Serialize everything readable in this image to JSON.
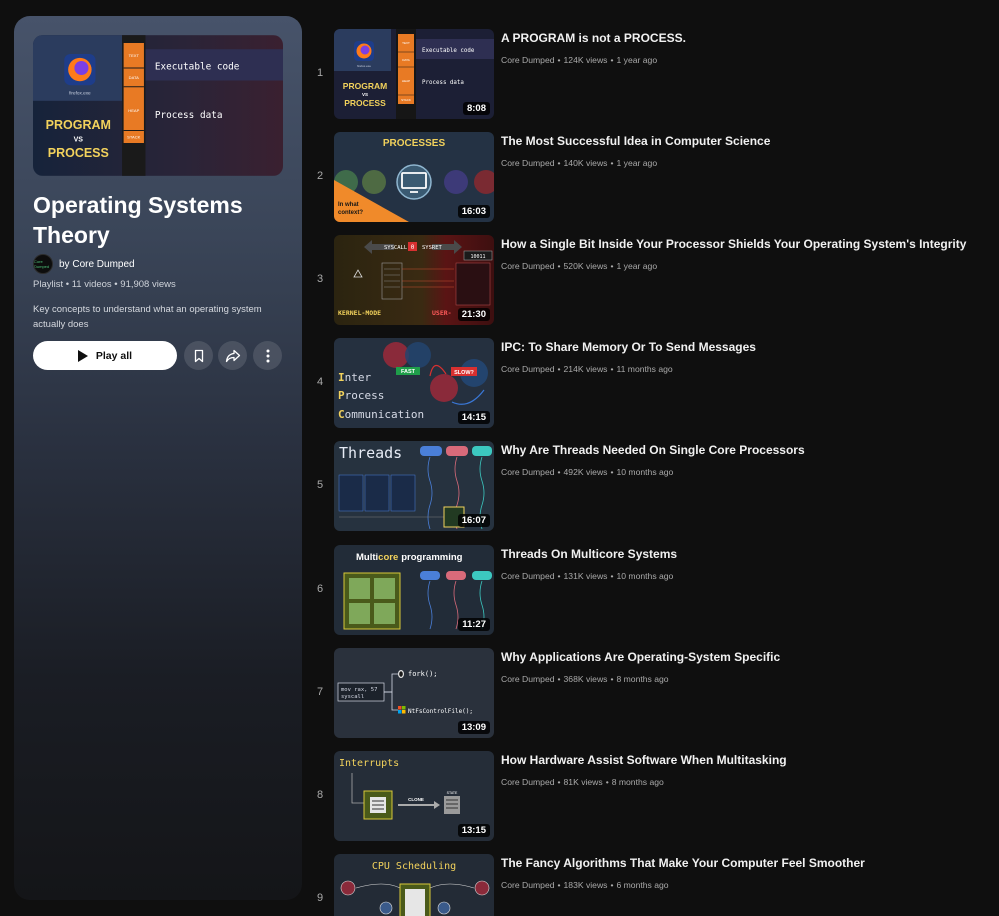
{
  "playlist": {
    "cover": {
      "title_line1": "PROGRAM",
      "title_vs": "VS",
      "title_line2": "PROCESS",
      "app_name": "firefox.exe",
      "segments": [
        "TEXT",
        "DATA",
        "HEAP",
        "STACK"
      ],
      "label_code": "Executable code",
      "label_data": "Process data"
    },
    "title": "Operating Systems Theory",
    "owner_prefix": "by",
    "owner": "Core Dumped",
    "avatar_text": "Core Dumped",
    "type": "Playlist",
    "video_count": "11 videos",
    "views": "91,908 views",
    "description": "Key concepts to understand what an operating system actually does",
    "play_all_label": "Play all"
  },
  "videos": [
    {
      "index": "1",
      "title": "A PROGRAM is not a PROCESS.",
      "channel": "Core Dumped",
      "views": "124K views",
      "age": "1 year ago",
      "duration": "8:08",
      "thumb": {
        "t1": "PROGRAM",
        "t2": "VS",
        "t3": "PROCESS",
        "app": "firefox.exe",
        "seg": [
          "TEXT",
          "DATA",
          "HEAP",
          "STACK"
        ],
        "code": "Executable code",
        "data": "Process data"
      }
    },
    {
      "index": "2",
      "title": "The Most Successful Idea in Computer Science",
      "channel": "Core Dumped",
      "views": "140K views",
      "age": "1 year ago",
      "duration": "16:03",
      "thumb": {
        "heading": "PROCESSES",
        "corner1": "In what",
        "corner2": "context?"
      }
    },
    {
      "index": "3",
      "title": "How a Single Bit Inside Your Processor Shields Your Operating System's Integrity",
      "channel": "Core Dumped",
      "views": "520K views",
      "age": "1 year ago",
      "duration": "21:30",
      "thumb": {
        "syscall": "SYSCALL",
        "bit": "0",
        "sysret": "SYSRET",
        "reg": "10011",
        "kernel": "KERNEL-MODE",
        "user": "USER-"
      }
    },
    {
      "index": "4",
      "title": "IPC: To Share Memory Or To Send Messages",
      "channel": "Core Dumped",
      "views": "214K views",
      "age": "11 months ago",
      "duration": "14:15",
      "thumb": {
        "l1a": "I",
        "l1b": "nter",
        "l2a": "P",
        "l2b": "rocess",
        "l3a": "C",
        "l3b": "ommunication",
        "fast": "FAST",
        "slow": "SLOW?"
      }
    },
    {
      "index": "5",
      "title": "Why Are Threads Needed On Single Core Processors",
      "channel": "Core Dumped",
      "views": "492K views",
      "age": "10 months ago",
      "duration": "16:07",
      "thumb": {
        "heading": "Threads"
      }
    },
    {
      "index": "6",
      "title": "Threads On Multicore Systems",
      "channel": "Core Dumped",
      "views": "131K views",
      "age": "10 months ago",
      "duration": "11:27",
      "thumb": {
        "multi": "Multi",
        "core": "core",
        "prog": "programming"
      }
    },
    {
      "index": "7",
      "title": "Why Applications Are Operating-System Specific",
      "channel": "Core Dumped",
      "views": "368K views",
      "age": "8 months ago",
      "duration": "13:09",
      "thumb": {
        "asm1": "mov rax, 57",
        "asm2": "syscall",
        "fork": "fork();",
        "nt": "NtFsControlFile();"
      }
    },
    {
      "index": "8",
      "title": "How Hardware Assist Software When Multitasking",
      "channel": "Core Dumped",
      "views": "81K views",
      "age": "8 months ago",
      "duration": "13:15",
      "thumb": {
        "heading": "Interrupts",
        "clone": "CLONE",
        "state": "STATE"
      }
    },
    {
      "index": "9",
      "title": "The Fancy Algorithms That Make Your Computer Feel Smoother",
      "channel": "Core Dumped",
      "views": "183K views",
      "age": "6 months ago",
      "duration": "",
      "thumb": {
        "heading": "CPU Scheduling"
      }
    }
  ]
}
